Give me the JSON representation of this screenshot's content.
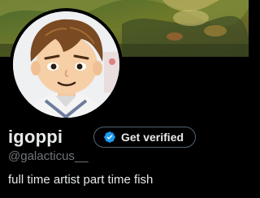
{
  "profile": {
    "display_name": "igoppi",
    "handle": "@galacticus__",
    "bio": "full time artist part time fish",
    "get_verified_label": "Get verified"
  },
  "banner": {
    "description_icon": "banner-image"
  },
  "avatar": {
    "icon": "mii-avatar-icon"
  },
  "colors": {
    "background": "#000000",
    "primary_text": "#e7e9ea",
    "secondary_text": "#71767b",
    "button_border": "#536471",
    "verified_blue": "#1d9bf0"
  }
}
